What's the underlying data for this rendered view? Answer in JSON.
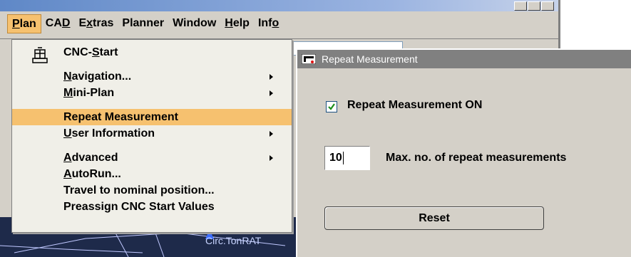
{
  "menubar": {
    "items": [
      {
        "label": "Plan",
        "accel": "P",
        "rest": "lan"
      },
      {
        "label": "CAD",
        "pre": "CA",
        "accel": "D",
        "rest": ""
      },
      {
        "label": "Extras",
        "pre": "E",
        "accel": "x",
        "rest": "tras"
      },
      {
        "label": "Planner"
      },
      {
        "label": "Window"
      },
      {
        "label": "Help",
        "accel": "H",
        "rest": "elp"
      },
      {
        "label": "Info",
        "pre": "Inf",
        "accel": "o",
        "rest": ""
      }
    ]
  },
  "plan_menu": {
    "items": [
      {
        "pre": "CNC-",
        "accel": "S",
        "rest": "tart",
        "submenu": false
      },
      {
        "pre": "",
        "accel": "N",
        "rest": "avigation...",
        "submenu": true
      },
      {
        "pre": "",
        "accel": "M",
        "rest": "ini-Plan",
        "submenu": true
      },
      {
        "pre": "Repeat Measurement",
        "accel": "",
        "rest": "",
        "submenu": false,
        "highlighted": true
      },
      {
        "pre": "",
        "accel": "U",
        "rest": "ser Information",
        "submenu": true
      },
      {
        "pre": "",
        "accel": "A",
        "rest": "dvanced",
        "submenu": true
      },
      {
        "pre": "",
        "accel": "A",
        "rest": "utoRun...",
        "submenu": false
      },
      {
        "pre": "Travel to nominal position...",
        "accel": "",
        "rest": "",
        "submenu": false
      },
      {
        "pre": "Preassign CNC Start Values",
        "accel": "",
        "rest": "",
        "submenu": false
      }
    ]
  },
  "dialog": {
    "title": "Repeat Measurement",
    "checkbox_label": "Repeat Measurement ON",
    "checked": true,
    "count_value": "10",
    "count_label": "Max. no. of repeat measurements",
    "reset_label": "Reset"
  },
  "cad": {
    "label": "Circ.TonRAT"
  },
  "colors": {
    "highlight": "#f6c16f",
    "dialog_bg": "#d4d0c8",
    "menu_bg": "#f0efe8"
  }
}
